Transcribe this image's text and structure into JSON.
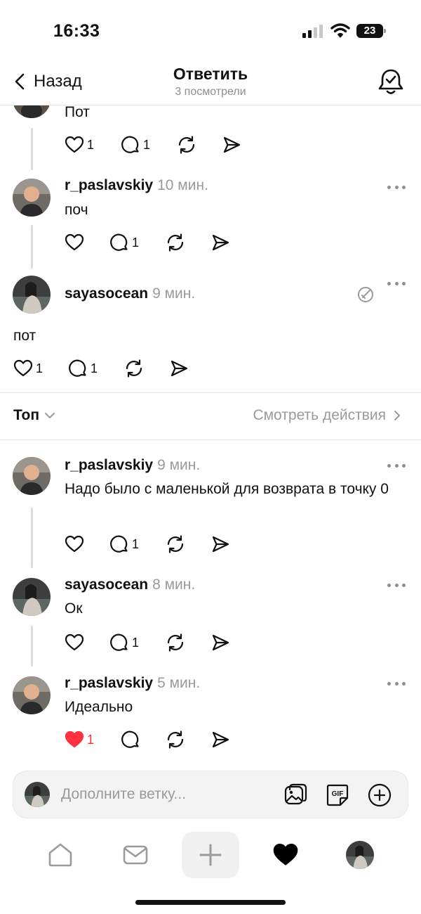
{
  "status": {
    "time": "16:33",
    "battery": "23"
  },
  "header": {
    "back_label": "Назад",
    "title": "Ответить",
    "subtitle": "3 посмотрели"
  },
  "posts": [
    {
      "username": "",
      "time": "",
      "text": "Пот",
      "likes": "1",
      "replies": "1",
      "liked": false
    },
    {
      "username": "r_paslavskiy",
      "time": "10 мин.",
      "text": "поч",
      "likes": "",
      "replies": "1",
      "liked": false
    },
    {
      "username": "sayasocean",
      "time": "9 мин.",
      "text": "пот",
      "likes": "1",
      "replies": "1",
      "liked": false
    }
  ],
  "replies_bar": {
    "sort_label": "Топ",
    "activity_label": "Смотреть действия"
  },
  "replies": [
    {
      "username": "r_paslavskiy",
      "time": "9 мин.",
      "text": "Надо было с маленькой для возврата в точку 0",
      "likes": "",
      "replies": "1",
      "liked": false
    },
    {
      "username": "sayasocean",
      "time": "8 мин.",
      "text": "Ок",
      "likes": "",
      "replies": "1",
      "liked": false
    },
    {
      "username": "r_paslavskiy",
      "time": "5 мин.",
      "text": "Идеально",
      "likes": "1",
      "replies": "",
      "liked": true
    }
  ],
  "composer": {
    "placeholder": "Дополните ветку..."
  },
  "colors": {
    "like_active": "#ff3040",
    "muted": "#9a9a9a",
    "divider": "#e6e6e6"
  }
}
